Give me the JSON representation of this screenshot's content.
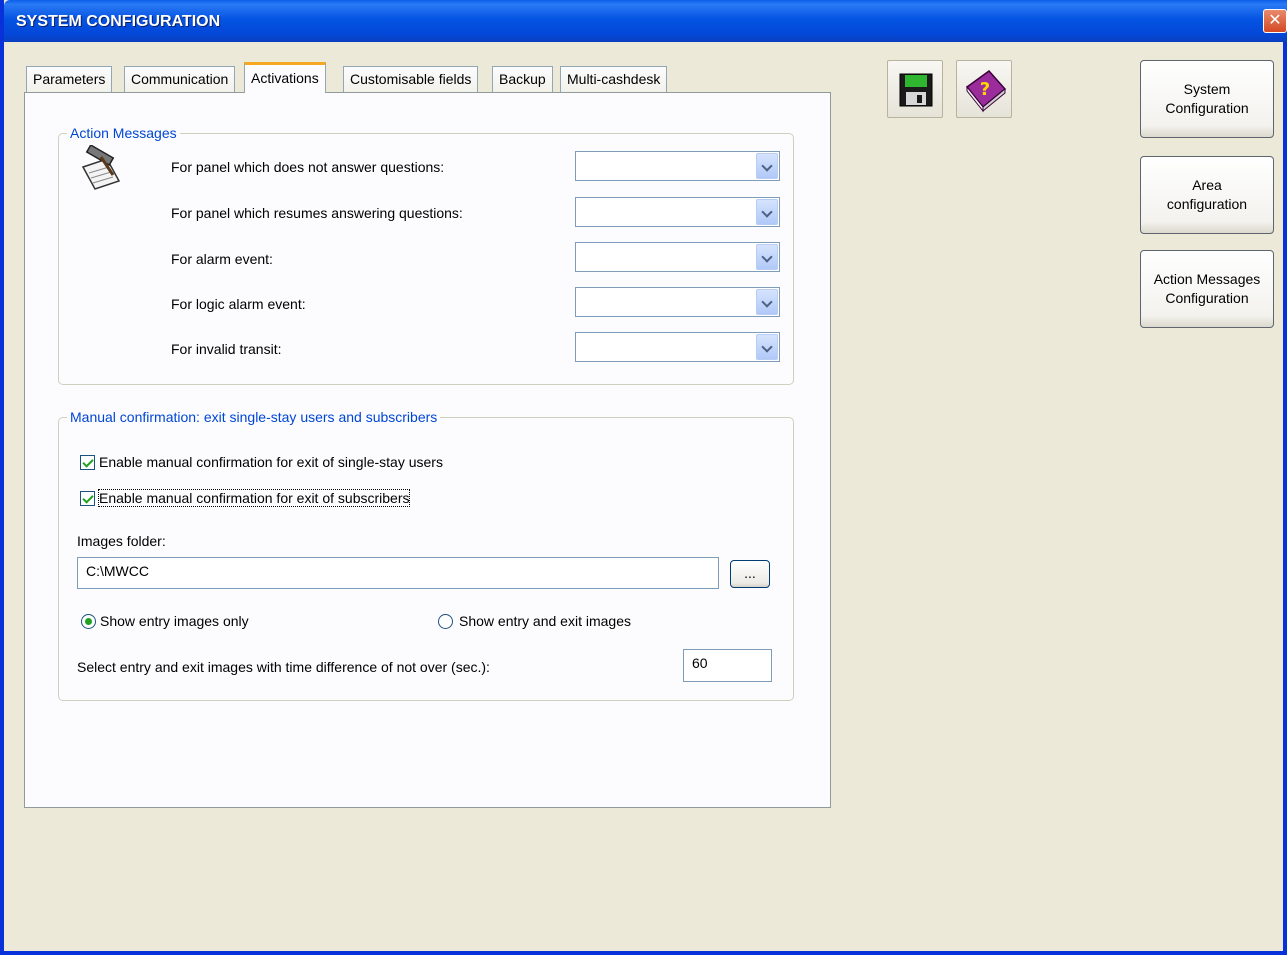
{
  "window": {
    "title": "SYSTEM CONFIGURATION",
    "close_label": "✕"
  },
  "tabs": [
    {
      "label": "Parameters"
    },
    {
      "label": "Communication"
    },
    {
      "label": "Activations"
    },
    {
      "label": "Customisable fields"
    },
    {
      "label": "Backup"
    },
    {
      "label": "Multi-cashdesk"
    }
  ],
  "action_messages": {
    "legend": "Action Messages",
    "rows": [
      {
        "label": "For panel which does not answer questions:",
        "value": ""
      },
      {
        "label": "For panel which resumes answering questions:",
        "value": ""
      },
      {
        "label": "For alarm event:",
        "value": ""
      },
      {
        "label": "For logic alarm event:",
        "value": ""
      },
      {
        "label": "For invalid transit:",
        "value": ""
      }
    ]
  },
  "manual_confirmation": {
    "legend": "Manual confirmation: exit single-stay users and subscribers",
    "check_single_stay": {
      "label": "Enable manual confirmation for exit of single-stay users",
      "checked": true
    },
    "check_subscribers": {
      "label": "Enable manual confirmation for exit of subscribers",
      "checked": true
    },
    "images_folder_label": "Images folder:",
    "images_folder_value": "C:\\MWCC",
    "browse_label": "...",
    "radio_entry_only": {
      "label": "Show entry images only",
      "checked": true
    },
    "radio_entry_exit": {
      "label": "Show entry and exit images",
      "checked": false
    },
    "time_diff_label": "Select entry and exit images with time difference of not over (sec.):",
    "time_diff_value": "60"
  },
  "toolbar": {
    "save_icon": "floppy-disk-icon",
    "help_icon": "help-book-icon"
  },
  "side_buttons": [
    {
      "label": "System\nConfiguration"
    },
    {
      "label": "Area\nconfiguration"
    },
    {
      "label": "Action Messages\nConfiguration"
    }
  ]
}
